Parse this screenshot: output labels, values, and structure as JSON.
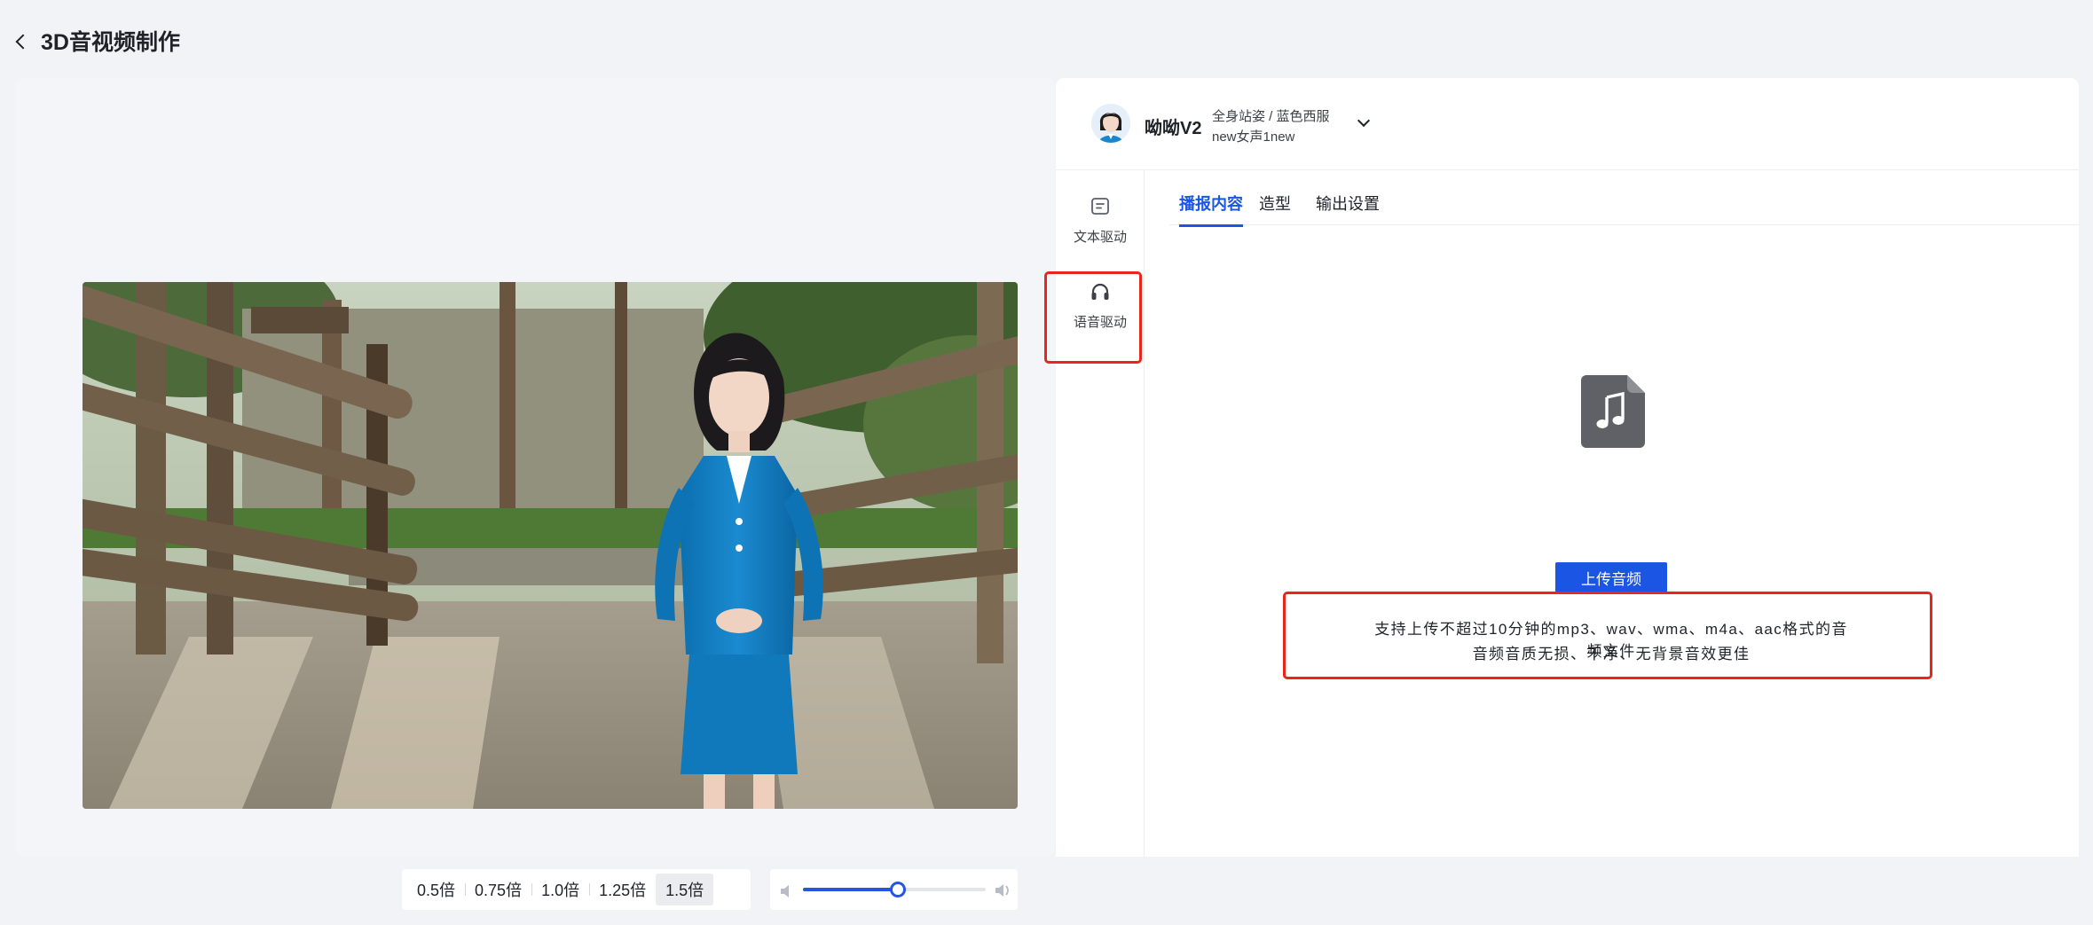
{
  "header": {
    "title": "3D音视频制作"
  },
  "avatar": {
    "name": "呦呦V2",
    "style": "全身站姿 / 蓝色西服",
    "voice": "new女声1new"
  },
  "sidebar": {
    "items": [
      {
        "label": "文本驱动",
        "icon": "text-doc-icon"
      },
      {
        "label": "语音驱动",
        "icon": "headphones-icon"
      }
    ]
  },
  "tabs": [
    {
      "label": "播报内容",
      "active": true
    },
    {
      "label": "造型",
      "active": false
    },
    {
      "label": "输出设置",
      "active": false
    }
  ],
  "upload": {
    "icon": "music-file-icon",
    "button_label": "上传音频",
    "hint_line1": "支持上传不超过10分钟的mp3、wav、wma、m4a、aac格式的音频文件",
    "hint_line2": "音频音质无损、干净、无背景音效更佳"
  },
  "player": {
    "speeds": [
      "0.5倍",
      "0.75倍",
      "1.0倍",
      "1.25倍",
      "1.5倍"
    ],
    "selected_speed": "1.5倍",
    "volume_level": 0.52
  },
  "colors": {
    "accent": "#1a55e3",
    "highlight": "#e8271a",
    "background": "#f2f3f7"
  }
}
